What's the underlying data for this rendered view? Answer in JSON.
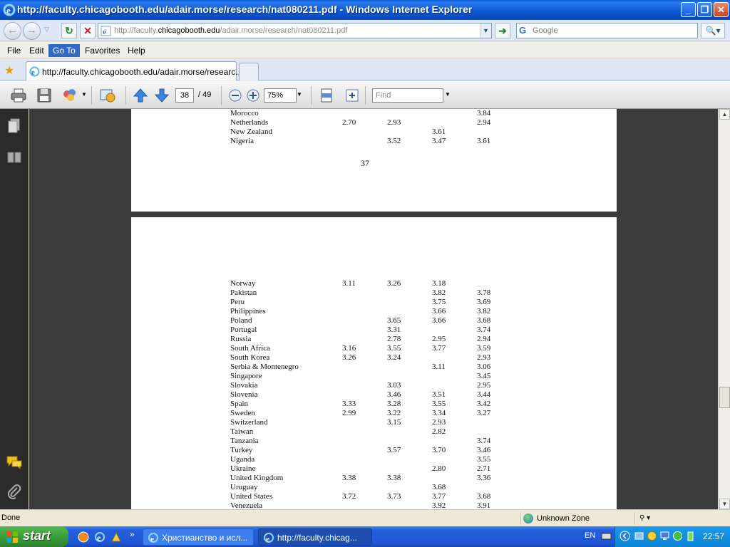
{
  "window": {
    "title": "http://faculty.chicagobooth.edu/adair.morse/research/nat080211.pdf - Windows Internet Explorer"
  },
  "address": {
    "url_prefix": "http://faculty.",
    "url_host": "chicagobooth.edu",
    "url_path": "/adair.morse/research/nat080211.pdf",
    "search_placeholder": "Google"
  },
  "menu": {
    "items": [
      "File",
      "Edit",
      "Go To",
      "Favorites",
      "Help"
    ],
    "active": "Go To"
  },
  "tabs": {
    "active_title": "http://faculty.chicagobooth.edu/adair.morse/researc..."
  },
  "pdf_toolbar": {
    "current_page": "38",
    "total_pages": "/ 49",
    "zoom": "75%",
    "find_placeholder": "Find"
  },
  "document": {
    "page37_number": "37",
    "page37_rows": [
      [
        "Morocco",
        "",
        "",
        "",
        "3.84"
      ],
      [
        "Netherlands",
        "2.70",
        "2.93",
        "",
        "2.94"
      ],
      [
        "New Zealand",
        "",
        "",
        "3.61",
        ""
      ],
      [
        "Nigeria",
        "",
        "3.52",
        "3.47",
        "3.61"
      ]
    ],
    "page38_rows": [
      [
        "Norway",
        "3.11",
        "3.26",
        "3.18",
        ""
      ],
      [
        "Pakistan",
        "",
        "",
        "3.82",
        "3.78"
      ],
      [
        "Peru",
        "",
        "",
        "3.75",
        "3.69"
      ],
      [
        "Philippines",
        "",
        "",
        "3.66",
        "3.82"
      ],
      [
        "Poland",
        "",
        "3.65",
        "3.66",
        "3.68"
      ],
      [
        "Portugal",
        "",
        "3.31",
        "",
        "3.74"
      ],
      [
        "Russia",
        "",
        "2.78",
        "2.95",
        "2.94"
      ],
      [
        "South Africa",
        "3.16",
        "3.55",
        "3.77",
        "3.59"
      ],
      [
        "South Korea",
        "3.26",
        "3.24",
        "",
        "2.93"
      ],
      [
        "Serbia & Montenegro",
        "",
        "",
        "3.11",
        "3.06"
      ],
      [
        "Singapore",
        "",
        "",
        "",
        "3.45"
      ],
      [
        "Slovakia",
        "",
        "3.03",
        "",
        "2.95"
      ],
      [
        "Slovenia",
        "",
        "3.46",
        "3.51",
        "3.44"
      ],
      [
        "Spain",
        "3.33",
        "3.28",
        "3.55",
        "3.42"
      ],
      [
        "Sweden",
        "2.99",
        "3.22",
        "3.34",
        "3.27"
      ],
      [
        "Switzerland",
        "",
        "3.15",
        "2.93",
        ""
      ],
      [
        "Taiwan",
        "",
        "",
        "2.82",
        ""
      ],
      [
        "Tanzania",
        "",
        "",
        "",
        "3.74"
      ],
      [
        "Turkey",
        "",
        "3.57",
        "3.70",
        "3.46"
      ],
      [
        "Uganda",
        "",
        "",
        "",
        "3.55"
      ],
      [
        "Ukraine",
        "",
        "",
        "2.80",
        "2.71"
      ],
      [
        "United Kingdom",
        "3.38",
        "3.38",
        "",
        "3.36"
      ],
      [
        "Uruguay",
        "",
        "",
        "3.68",
        ""
      ],
      [
        "United States",
        "3.72",
        "3.73",
        "3.77",
        "3.68"
      ],
      [
        "Venezuela",
        "",
        "",
        "3.92",
        "3.91"
      ]
    ]
  },
  "statusbar": {
    "text": "Done",
    "zone": "Unknown Zone",
    "zoom": "⚲ ▾"
  },
  "taskbar": {
    "start_label": "start",
    "items": [
      {
        "label": "Христианство и исл...",
        "active": false
      },
      {
        "label": "http://faculty.chicag...",
        "active": true
      }
    ],
    "language": "EN",
    "clock": "22:57"
  },
  "colors": {
    "titlebar_blue": "#0b57d0",
    "menu_active": "#316ac5",
    "doc_background": "#3b3b3b",
    "start_green": "#389a38"
  }
}
